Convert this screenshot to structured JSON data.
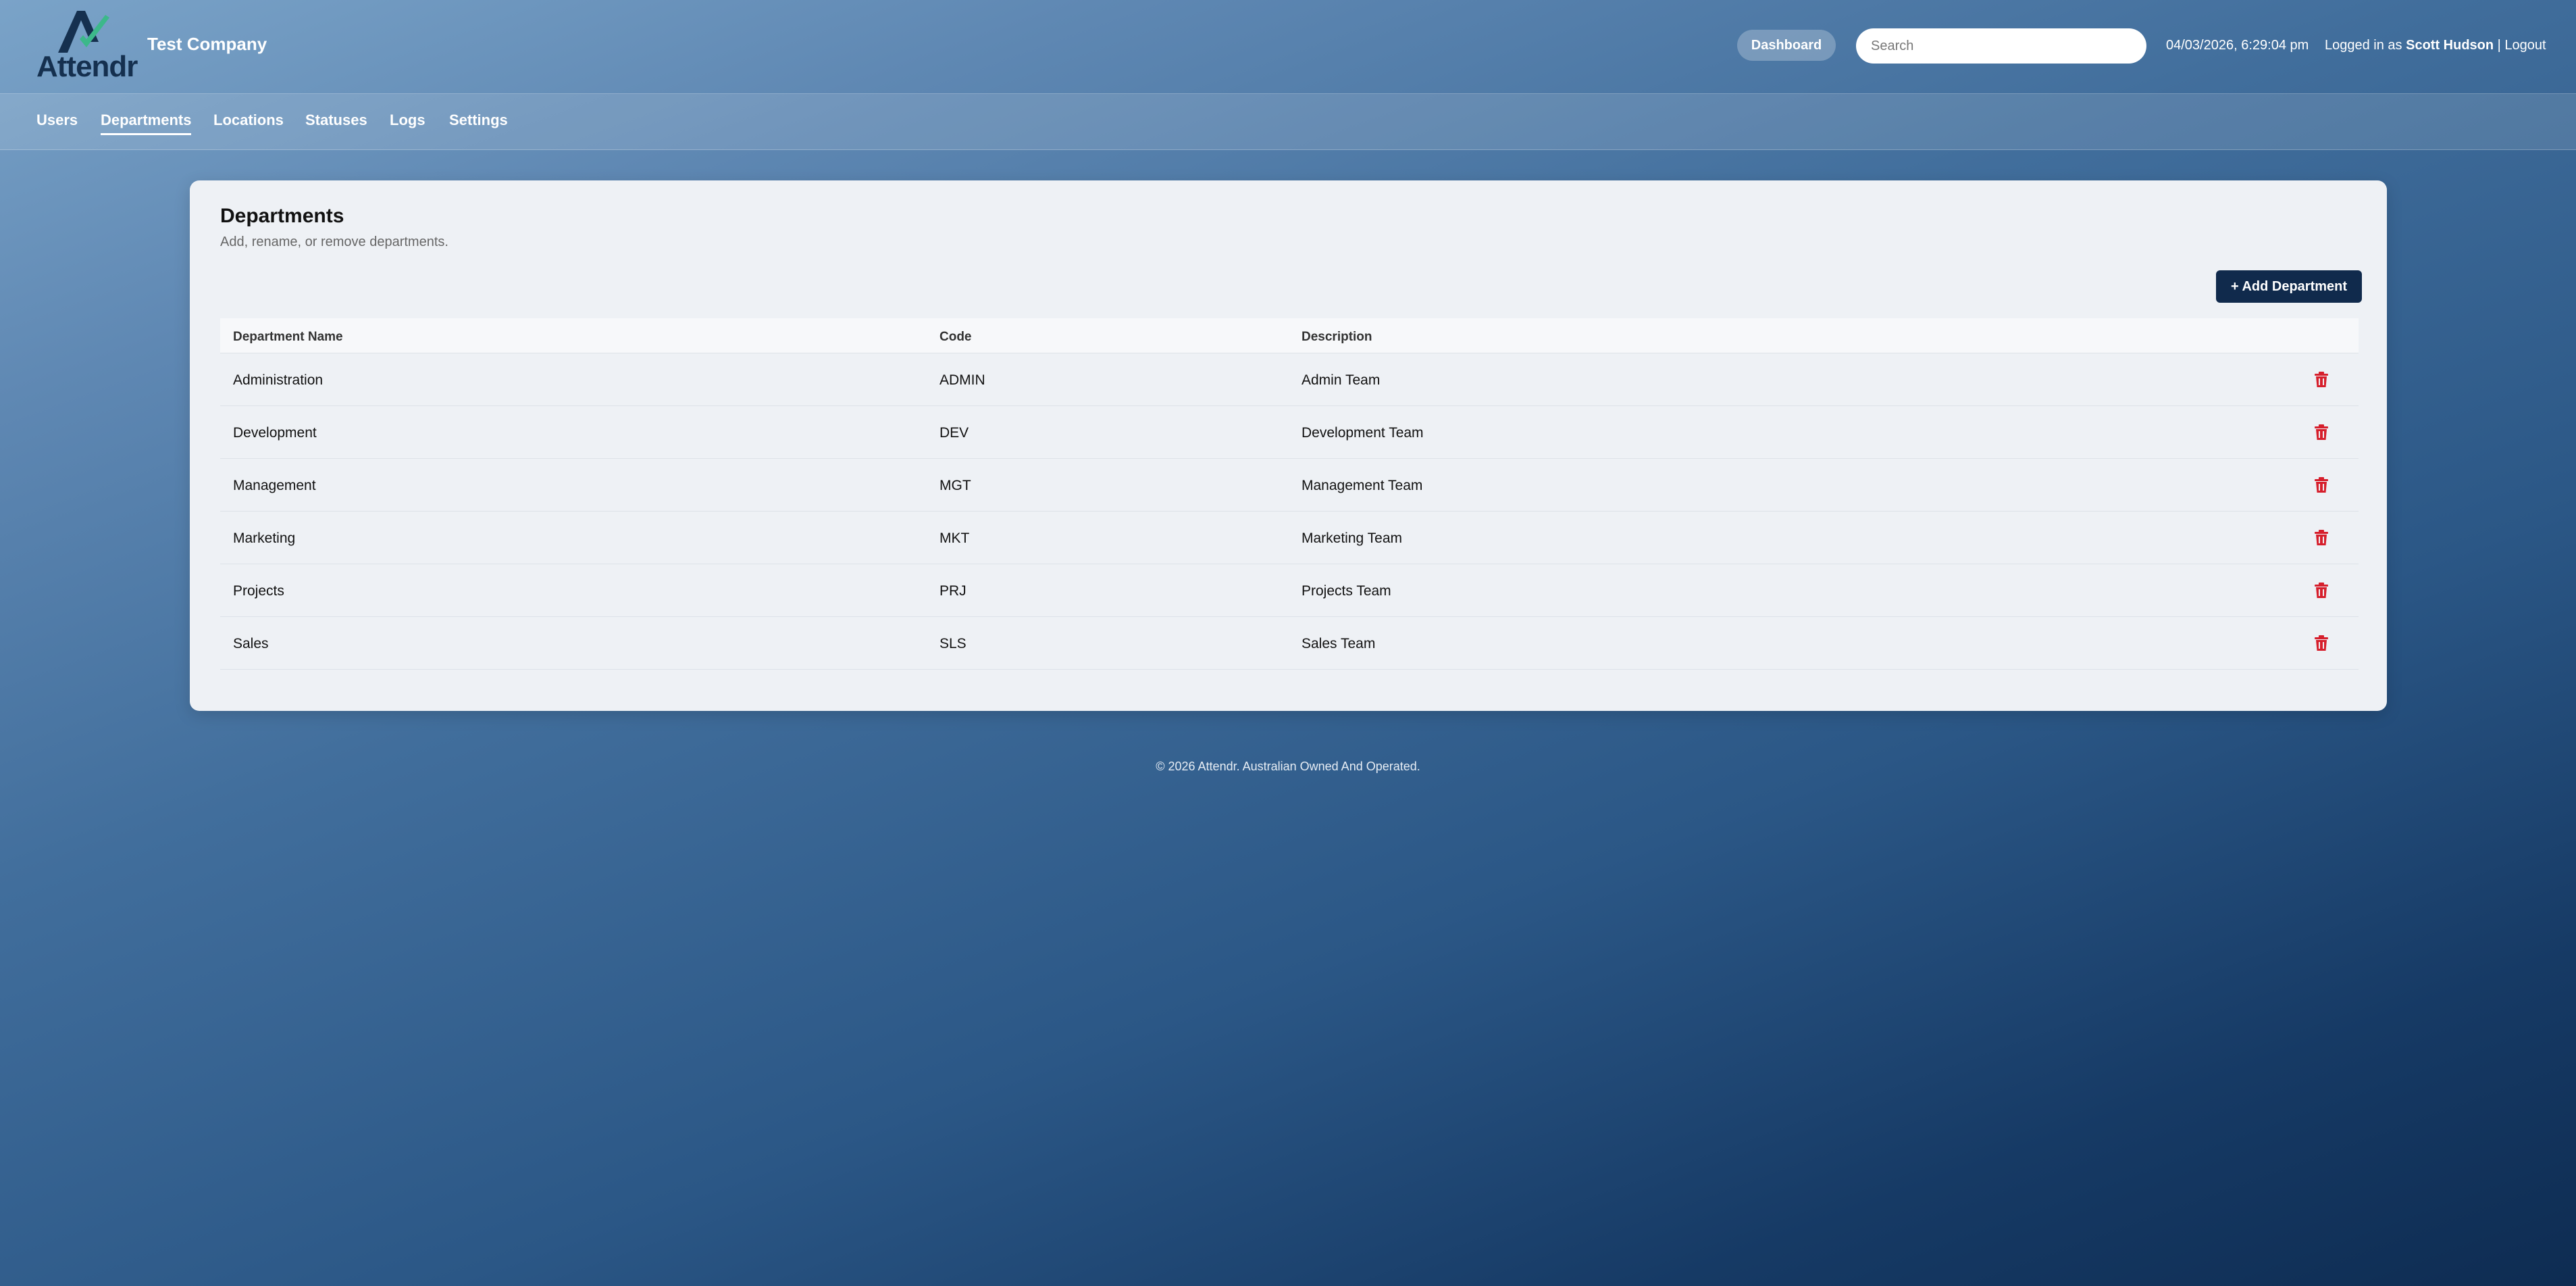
{
  "header": {
    "logo_text": "Attendr",
    "company": "Test Company",
    "dashboard_label": "Dashboard",
    "search_placeholder": "Search",
    "datetime": "04/03/2026, 6:29:04 pm",
    "logged_in_prefix": "Logged in as ",
    "user_name": "Scott Hudson",
    "separator": " | ",
    "logout_label": "Logout"
  },
  "nav": {
    "items": [
      "Users",
      "Departments",
      "Locations",
      "Statuses",
      "Logs",
      "Settings"
    ],
    "active": "Departments"
  },
  "page": {
    "title": "Departments",
    "subtitle": "Add, rename, or remove departments.",
    "add_button": "+ Add Department"
  },
  "table": {
    "headers": [
      "Department Name",
      "Code",
      "Description"
    ],
    "rows": [
      {
        "name": "Administration",
        "code": "ADMIN",
        "description": "Admin Team"
      },
      {
        "name": "Development",
        "code": "DEV",
        "description": "Development Team"
      },
      {
        "name": "Management",
        "code": "MGT",
        "description": "Management Team"
      },
      {
        "name": "Marketing",
        "code": "MKT",
        "description": "Marketing Team"
      },
      {
        "name": "Projects",
        "code": "PRJ",
        "description": "Projects Team"
      },
      {
        "name": "Sales",
        "code": "SLS",
        "description": "Sales Team"
      }
    ]
  },
  "footer": "© 2026 Attendr. Australian Owned And Operated.",
  "colors": {
    "brand_dark": "#102a4c",
    "delete_red": "#d61f2c",
    "logo_check": "#3cb88a"
  },
  "icons": {
    "delete": "trash-icon",
    "logo": "attendr-logo-icon"
  }
}
